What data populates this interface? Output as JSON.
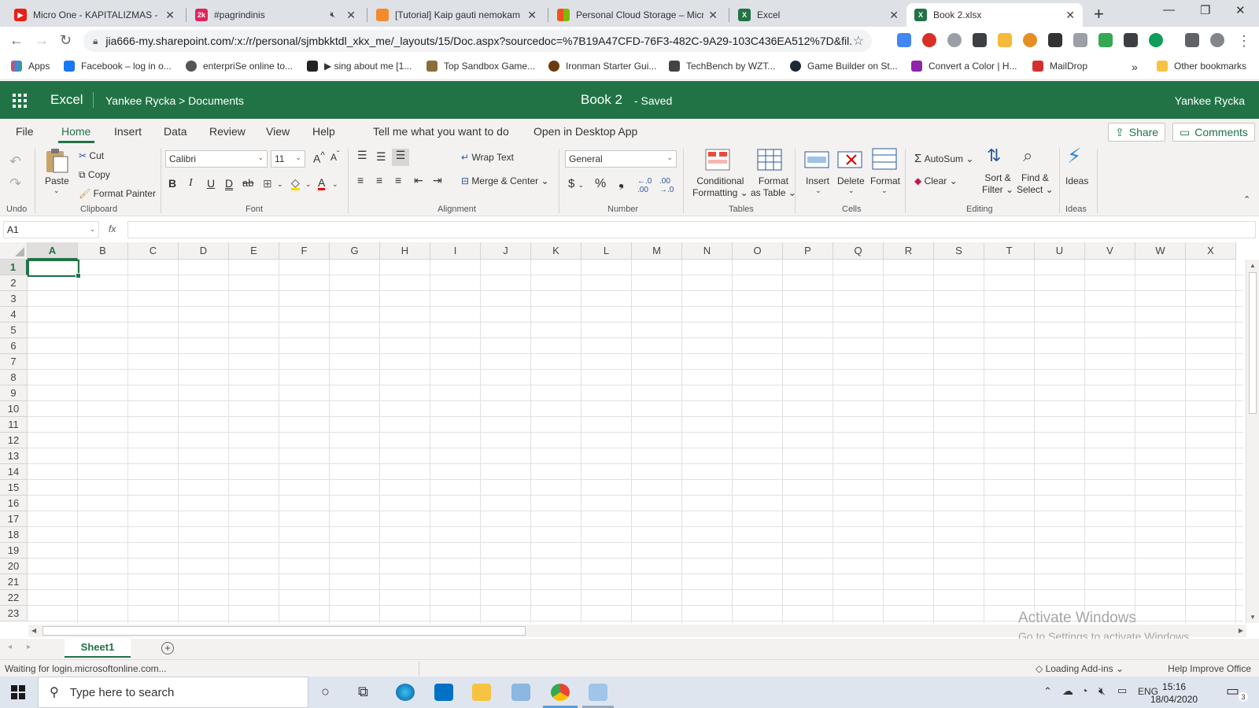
{
  "browser": {
    "tabs": [
      {
        "title": "Micro One - KAPITALIZMAS - Y",
        "color": "#e62117"
      },
      {
        "title": "#pagrindinis",
        "color": "#e0245e"
      },
      {
        "title": "[Tutorial] Kaip gauti nemokam",
        "color": "#f28b2b"
      },
      {
        "title": "Personal Cloud Storage – Micro",
        "color": "#0078d4"
      },
      {
        "title": "Excel",
        "color": "#217346"
      },
      {
        "title": "Book 2.xlsx",
        "color": "#217346"
      }
    ],
    "url": "jia666-my.sharepoint.com/:x:/r/personal/sjmbkktdl_xkx_me/_layouts/15/Doc.aspx?sourcedoc=%7B19A47CFD-76F3-482C-9A29-103C436EA512%7D&fil...",
    "bookmarks": [
      {
        "label": "Apps"
      },
      {
        "label": "Facebook – log in o..."
      },
      {
        "label": "enterpriSe online to..."
      },
      {
        "label": "▶ sing about me [1..."
      },
      {
        "label": "Top Sandbox Game..."
      },
      {
        "label": "Ironman Starter Gui..."
      },
      {
        "label": "TechBench by WZT..."
      },
      {
        "label": "Game Builder on St..."
      },
      {
        "label": "Convert a Color | H..."
      },
      {
        "label": "MailDrop"
      }
    ],
    "bookmarks_more": "»",
    "other_bookmarks": "Other bookmarks"
  },
  "excel": {
    "app_name": "Excel",
    "breadcrumb": "Yankee Rycka  >  Documents",
    "doc_name": "Book 2",
    "doc_status": "-   Saved",
    "user": "Yankee Rycka",
    "ribbon_tabs": [
      "File",
      "Home",
      "Insert",
      "Data",
      "Review",
      "View",
      "Help"
    ],
    "tell_me": "Tell me what you want to do",
    "open_desktop": "Open in Desktop App",
    "share": "Share",
    "comments": "Comments",
    "ribbon": {
      "paste": "Paste",
      "cut": "Cut",
      "copy": "Copy",
      "format_painter": "Format Painter",
      "font_name": "Calibri",
      "font_size": "11",
      "wrap_text": "Wrap Text",
      "merge_center": "Merge & Center",
      "number_format": "General",
      "conditional_formatting": [
        "Conditional",
        "Formatting ⌄"
      ],
      "format_as_table": [
        "Format",
        "as Table ⌄"
      ],
      "insert": "Insert",
      "delete": "Delete",
      "format": "Format",
      "autosum": "AutoSum",
      "clear": "Clear",
      "sort_filter": [
        "Sort &",
        "Filter ⌄"
      ],
      "find_select": [
        "Find &",
        "Select ⌄"
      ],
      "ideas": "Ideas",
      "groups": [
        "Undo",
        "Clipboard",
        "Font",
        "Alignment",
        "Number",
        "Tables",
        "Cells",
        "Editing",
        "Ideas"
      ]
    },
    "name_box": "A1",
    "fx": "fx",
    "columns": [
      "A",
      "B",
      "C",
      "D",
      "E",
      "F",
      "G",
      "H",
      "I",
      "J",
      "K",
      "L",
      "M",
      "N",
      "O",
      "P",
      "Q",
      "R",
      "S",
      "T",
      "U",
      "V",
      "W",
      "X"
    ],
    "rows": [
      "1",
      "2",
      "3",
      "4",
      "5",
      "6",
      "7",
      "8",
      "9",
      "10",
      "11",
      "12",
      "13",
      "14",
      "15",
      "16",
      "17",
      "18",
      "19",
      "20",
      "21",
      "22",
      "23"
    ],
    "active_cell": "A1",
    "sheet_name": "Sheet1",
    "watermark_line1": "Activate Windows",
    "watermark_line2": "Go to Settings to activate Windows.",
    "status_left": "Waiting for login.microsoftonline.com...",
    "status_mid": "Loading Add-ins",
    "status_right": "Help Improve Office"
  },
  "taskbar": {
    "search_placeholder": "Type here to search",
    "lang": "ENG",
    "time": "15:16",
    "date": "18/04/2020",
    "notif_count": "3"
  }
}
